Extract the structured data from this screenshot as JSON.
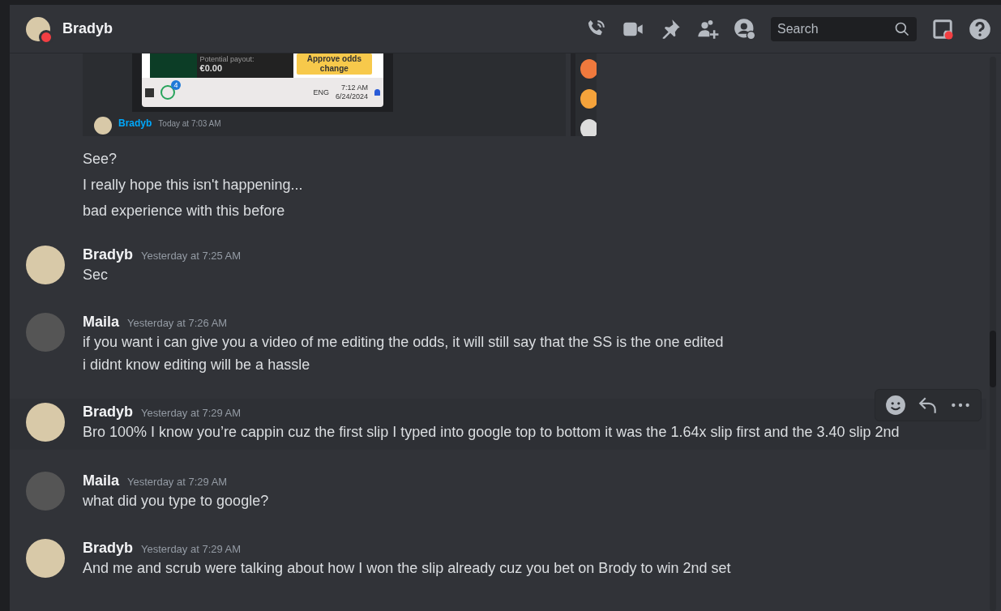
{
  "header": {
    "title": "Bradyb",
    "search": {
      "placeholder": "Search"
    }
  },
  "attachment": {
    "payout_label": "Potential payout:",
    "payout_value": "€0.00",
    "approve_button": "Approve odds change",
    "whatsapp_badge": "4",
    "language": "ENG",
    "time": "7:12 AM",
    "date": "6/24/2024",
    "quoted_author": "Bradyb",
    "quoted_time": "Today at 7:03 AM"
  },
  "continued_lines": [
    "See?",
    "I really hope this isn't happening...",
    "bad experience with this before"
  ],
  "messages": [
    {
      "author": "Bradyb",
      "color": "#d8c9a8",
      "timestamp": "Yesterday at 7:25 AM",
      "hovered": false,
      "lines": [
        "Sec"
      ]
    },
    {
      "author": "Maila",
      "color": "#555555",
      "timestamp": "Yesterday at 7:26 AM",
      "hovered": false,
      "lines": [
        "if you want i can give you a video of me editing the odds, it will still say that the SS is the one edited",
        "i didnt know editing will be a hassle"
      ]
    },
    {
      "author": "Bradyb",
      "color": "#d8c9a8",
      "timestamp": "Yesterday at 7:29 AM",
      "hovered": true,
      "lines": [
        "Bro 100% I know you’re cappin cuz the first slip I typed into google top to bottom it was the 1.64x slip first and the 3.40 slip 2nd"
      ]
    },
    {
      "author": "Maila",
      "color": "#555555",
      "timestamp": "Yesterday at 7:29 AM",
      "hovered": false,
      "lines": [
        "what did you type to google?"
      ]
    },
    {
      "author": "Bradyb",
      "color": "#d8c9a8",
      "timestamp": "Yesterday at 7:29 AM",
      "hovered": false,
      "lines": [
        "And me and scrub were talking about how I won the slip already cuz you bet on Brody to win 2nd set"
      ]
    }
  ]
}
